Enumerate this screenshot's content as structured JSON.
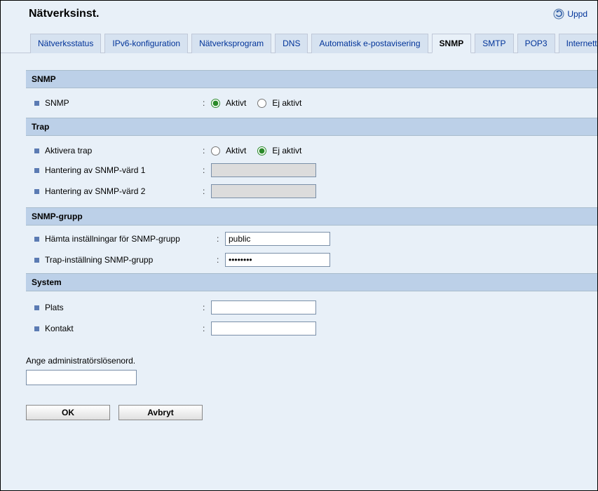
{
  "header": {
    "title": "Nätverksinst.",
    "refresh_label": "Uppd"
  },
  "tabs": [
    {
      "label": "Nätverksstatus",
      "active": false
    },
    {
      "label": "IPv6-konfiguration",
      "active": false
    },
    {
      "label": "Nätverksprogram",
      "active": false
    },
    {
      "label": "DNS",
      "active": false
    },
    {
      "label": "Automatisk e-postavisering",
      "active": false
    },
    {
      "label": "SNMP",
      "active": true
    },
    {
      "label": "SMTP",
      "active": false
    },
    {
      "label": "POP3",
      "active": false
    },
    {
      "label": "Internett",
      "active": false
    }
  ],
  "sections": {
    "snmp": {
      "title": "SNMP",
      "row_snmp": {
        "label": "SNMP",
        "option_active": "Aktivt",
        "option_inactive": "Ej aktivt",
        "selected": "active"
      }
    },
    "trap": {
      "title": "Trap",
      "row_enable": {
        "label": "Aktivera trap",
        "option_active": "Aktivt",
        "option_inactive": "Ej aktivt",
        "selected": "inactive"
      },
      "row_host1": {
        "label": "Hantering av SNMP-värd 1",
        "value": ""
      },
      "row_host2": {
        "label": "Hantering av SNMP-värd 2",
        "value": ""
      }
    },
    "group": {
      "title": "SNMP-grupp",
      "row_get": {
        "label": "Hämta inställningar för SNMP-grupp",
        "value": "public"
      },
      "row_trap": {
        "label": "Trap-inställning SNMP-grupp",
        "value": "••••••••"
      }
    },
    "system": {
      "title": "System",
      "row_place": {
        "label": "Plats",
        "value": ""
      },
      "row_contact": {
        "label": "Kontakt",
        "value": ""
      }
    }
  },
  "footer": {
    "admin_prompt": "Ange administratörslösenord.",
    "ok_label": "OK",
    "cancel_label": "Avbryt"
  }
}
